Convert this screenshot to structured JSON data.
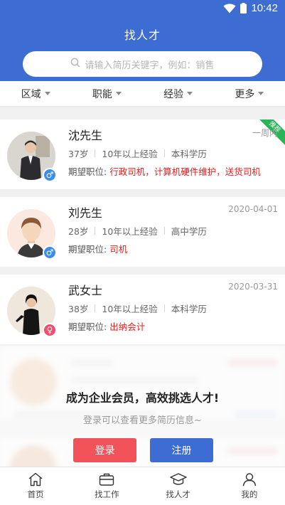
{
  "status": {
    "time": "10:42"
  },
  "header": {
    "title": "找人才"
  },
  "search": {
    "placeholder": "请输入简历关键字，例如：销售"
  },
  "filters": [
    {
      "label": "区域"
    },
    {
      "label": "职能"
    },
    {
      "label": "经验"
    },
    {
      "label": "更多"
    }
  ],
  "resumes": [
    {
      "name": "沈先生",
      "date": "一周内",
      "age": "37岁",
      "experience": "10年以上经验",
      "education": "本科学历",
      "expect_label": "期望职位:",
      "expect": "行政司机，计算机硬件维护，送货司机",
      "gender": "male",
      "badge": "推荐"
    },
    {
      "name": "刘先生",
      "date": "2020-04-01",
      "age": "28岁",
      "experience": "10年以上经验",
      "education": "高中学历",
      "expect_label": "期望职位:",
      "expect": "司机",
      "gender": "male"
    },
    {
      "name": "武女士",
      "date": "2020-03-31",
      "age": "38岁",
      "experience": "10年以上经验",
      "education": "本科学历",
      "expect_label": "期望职位:",
      "expect": "出纳会计",
      "gender": "female"
    }
  ],
  "promo": {
    "title": "成为企业会员，高效挑选人才!",
    "subtitle": "登录可以查看更多简历信息~",
    "login": "登录",
    "register": "注册"
  },
  "tabs": [
    {
      "label": "首页",
      "icon": "home-icon"
    },
    {
      "label": "找工作",
      "icon": "briefcase-icon"
    },
    {
      "label": "找人才",
      "icon": "graduation-cap-icon"
    },
    {
      "label": "我的",
      "icon": "user-icon"
    }
  ],
  "colors": {
    "primary": "#3d6cd3",
    "accent_red": "#e02020",
    "login_button": "#f2525a",
    "badge_green": "#2bb35a"
  }
}
